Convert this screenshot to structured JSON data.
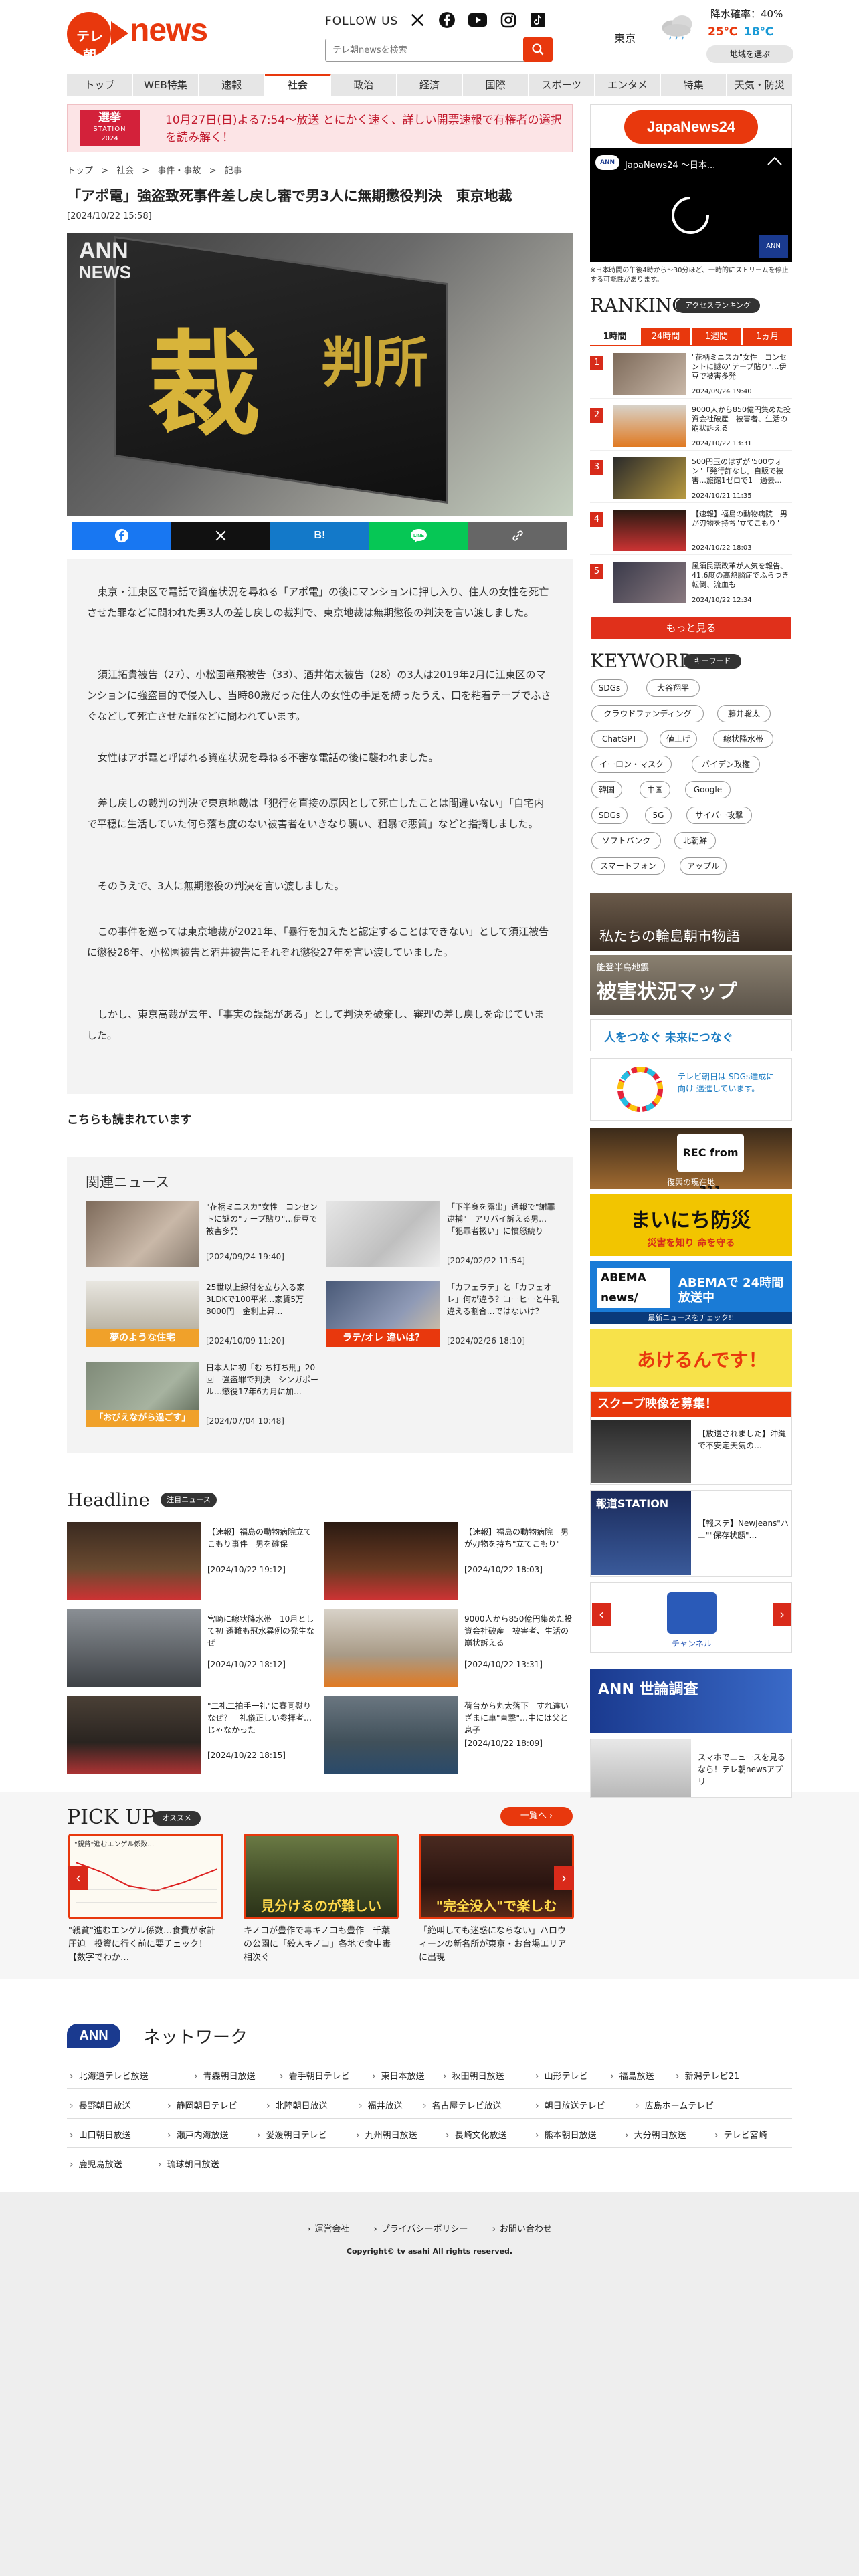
{
  "header": {
    "logo_tv": "テレ朝",
    "logo_news": "news",
    "follow_us": "FOLLOW US",
    "search_placeholder": "テレ朝newsを検索",
    "weather": {
      "city": "東京",
      "rain_label": "降水確率：40%",
      "high": "25℃",
      "low": "18℃",
      "pick_area": "地域を選ぶ"
    }
  },
  "nav": [
    "トップ",
    "WEB特集",
    "速報",
    "社会",
    "政治",
    "経済",
    "国際",
    "スポーツ",
    "エンタメ",
    "特集",
    "天気・防災"
  ],
  "nav_active": "社会",
  "election": {
    "logo_line1": "選挙",
    "logo_line2": "STATION",
    "logo_line3": "2024",
    "text": "10月27日(日)よる7:54〜放送 とにかく速く、詳しい開票速報で有権者の選択を読み解く！"
  },
  "breadcrumb": [
    "トップ",
    "社会",
    "事件・事故",
    "記事"
  ],
  "article": {
    "title": "「アポ電」強盗致死事件差し戻し審で男3人に無期懲役判決　東京地裁",
    "date": "[2024/10/22 15:58]",
    "image_watermark_1": "ANN",
    "image_watermark_2": "NEWS",
    "image_kanji_big": "裁",
    "image_kanji_small": "判所",
    "paragraphs": [
      "東京・江東区で電話で資産状況を尋ねる「アポ電」の後にマンションに押し入り、住人の女性を死亡させた罪などに問われた男3人の差し戻しの裁判で、東京地裁は無期懲役の判決を言い渡しました。",
      "須江拓貴被告（27）、小松園竜飛被告（33）、酒井佑太被告（28）の3人は2019年2月に江東区のマンションに強盗目的で侵入し、当時80歳だった住人の女性の手足を縛ったうえ、口を粘着テープでふさぐなどして死亡させた罪などに問われています。",
      "女性はアポ電と呼ばれる資産状況を尋ねる不審な電話の後に襲われました。",
      "差し戻しの裁判の判決で東京地裁は「犯行を直接の原因として死亡したことは間違いない」「自宅内で平穏に生活していた何ら落ち度のない被害者をいきなり襲い、粗暴で悪質」などと指摘しました。",
      "そのうえで、3人に無期懲役の判決を言い渡しました。",
      "この事件を巡っては東京地裁が2021年、「暴行を加えたと認定することはできない」として須江被告に懲役28年、小松園被告と酒井被告にそれぞれ懲役27年を言い渡していました。",
      "しかし、東京高裁が去年、「事実の誤認がある」として判決を破棄し、審理の差し戻しを命じていました。"
    ]
  },
  "read_also": "こちらも読まれています",
  "related": {
    "title": "関連ニュース",
    "items": [
      {
        "text": "\"花柄ミニスカ\"女性　コンセントに謎の\"テープ貼り\"…伊豆で被害多発",
        "date": "[2024/09/24 19:40]",
        "img_caption": ""
      },
      {
        "text": "「下半身を露出」通報で\"謝罪逮捕\"　アリバイ訴える男…「犯罪者扱い」に憤怒続り",
        "date": "[2024/02/22 11:54]",
        "img_caption": ""
      },
      {
        "text": "25世以上緑付を立ち入る家　3LDKで100平米…家賃5万8000円　金利上昇…",
        "date": "[2024/10/09 11:20]",
        "img_caption": "夢のような住宅"
      },
      {
        "text": "「カフェラテ」と「カフェオレ」何が違う？コーヒーと牛乳違える割合…ではないけ？",
        "date": "[2024/02/26 18:10]",
        "img_caption": "ラテ/オレ 違いは？"
      },
      {
        "text": "日本人に初「む ち打ち刑」20回　強盗罪で判決　シンガポール…懲役17年6カ月に加…",
        "date": "[2024/07/04 10:48]",
        "img_caption": "「おびえながら過ごす」"
      }
    ]
  },
  "headline": {
    "title": "Headline",
    "pill": "注目ニュース",
    "items": [
      {
        "text": "【速報】福島の動物病院立てこもり事件　男を確保",
        "date": "[2024/10/22 19:12]"
      },
      {
        "text": "【速報】福島の動物病院　男が刃物を持ち\"立てこもり\"",
        "date": "[2024/10/22 18:03]"
      },
      {
        "text": "宮崎に線状降水帯　10月として初 避難も冠水異例の発生なぜ",
        "date": "[2024/10/22 18:12]"
      },
      {
        "text": "9000人から850億円集めた投資会社破産　被害者、生活の崩状訴える",
        "date": "[2024/10/22 13:31]"
      },
      {
        "text": "\"二礼二拍手一礼\"に賽同慰り　なぜ？　礼儀正しい参拝者…じゃなかった",
        "date": "[2024/10/22 18:15]"
      },
      {
        "text": "荷台から丸太落下　すれ違いざまに車\"直撃\"…中には父と息子",
        "date": "[2024/10/22 18:09]"
      }
    ]
  },
  "pickup": {
    "title": "PICK UP",
    "pill": "オススメ",
    "all_link": "一覧へ ›",
    "items": [
      {
        "text": "\"親貧\"進むエンゲル係数…食費が家計圧迫　投資に行く前に要チェック！【数字でわか…",
        "caption": "\"親貧\"進むエンゲル係数…"
      },
      {
        "text": "キノコが豊作で毒キノコも豊作　千葉の公園に「殺人キノコ」各地で食中毒相次ぐ",
        "caption": "見分けるのが難しい"
      },
      {
        "text": "「絶叫しても迷惑にならない」ハロウィーンの新名所が東京・お台場エリアに出現",
        "caption": "\"完全没入\"で楽しむ"
      }
    ]
  },
  "network": {
    "logo": "ANN",
    "label": "ネットワーク",
    "rows": [
      [
        "北海道テレビ放送",
        "青森朝日放送",
        "岩手朝日テレビ",
        "東日本放送",
        "秋田朝日放送",
        "山形テレビ",
        "福島放送",
        "新潟テレビ21"
      ],
      [
        "長野朝日放送",
        "静岡朝日テレビ",
        "北陸朝日放送",
        "福井放送",
        "名古屋テレビ放送",
        "朝日放送テレビ",
        "広島ホームテレビ"
      ],
      [
        "山口朝日放送",
        "瀬戸内海放送",
        "愛媛朝日テレビ",
        "九州朝日放送",
        "長崎文化放送",
        "熊本朝日放送",
        "大分朝日放送",
        "テレビ宮崎"
      ],
      [
        "鹿児島放送",
        "琉球朝日放送"
      ]
    ]
  },
  "footer": {
    "links": [
      "運営会社",
      "プライバシーポリシー",
      "お問い合わせ"
    ],
    "copyright": "Copyright© tv asahi All rights reserved."
  },
  "sidebar": {
    "japannews24": "JapaNews24",
    "video_title": "JapaNews24 ～日本...",
    "video_note": "※日本時間の午後4時から～30分ほど、一時的にストリームを停止する可能性があります。",
    "ranking_title": "RANKING",
    "ranking_pill": "アクセスランキング",
    "ranking_tabs": [
      "1時間",
      "24時間",
      "1週間",
      "1ヵ月"
    ],
    "ranking_items": [
      {
        "rank": "1",
        "text": "\"花柄ミニスカ\"女性　コンセントに謎の\"テープ貼り\"…伊豆で被害多発",
        "date": "2024/09/24 19:40"
      },
      {
        "rank": "2",
        "text": "9000人から850億円集めた投資会社破産　被害者、生活の崩状訴える",
        "date": "2024/10/22 13:31"
      },
      {
        "rank": "3",
        "text": "500円玉のはずが\"500ウォン\"「発行許なし」自販で被害…旅館1ゼロで1　過去...",
        "date": "2024/10/21 11:35"
      },
      {
        "rank": "4",
        "text": "【速報】福島の動物病院　男が刃物を持ち\"立てこもり\"",
        "date": "2024/10/22 18:03"
      },
      {
        "rank": "5",
        "text": "風須民票改革が人気を報告、41.6度の高熱脳症でふらつき転倒、流血も",
        "date": "2024/10/22 12:34"
      }
    ],
    "ranking_more": "もっと見る",
    "keyword_title": "KEYWORD",
    "keyword_pill": "キーワード",
    "keywords": [
      [
        "SDGs",
        "大谷翔平"
      ],
      [
        "クラウドファンディング",
        "藤井聡太"
      ],
      [
        "ChatGPT",
        "値上げ",
        "線状降水帯"
      ],
      [
        "イーロン・マスク",
        "バイデン政権"
      ],
      [
        "韓国",
        "中国",
        "Google"
      ],
      [
        "SDGs",
        "5G",
        "サイバー攻撃"
      ],
      [
        "ソフトバンク",
        "北朝鮮"
      ],
      [
        "スマートフォン",
        "アップル"
      ]
    ],
    "banners": {
      "wajima": "私たちの輪島朝市物語",
      "noto_map_top": "能登半島地震",
      "noto_map": "被害状況マップ",
      "sdgs1": "人をつなぐ 未来につなぐ",
      "sdgs2": "テレビ朝日は SDGs達成に向け 邁進しています。",
      "rec311": "REC from 311",
      "rec311_sub": "復興の現在地",
      "bousai": "まいにち防災",
      "bousai_sub": "災害を知り 命を守る",
      "abema_news": "ABEMA news/",
      "abema_text": "ABEMAで 24時間放送中",
      "abema_sub": "最新ニュースをチェック!!",
      "akedan": "あけるんです！",
      "scoop": "スクープ映像を募集！",
      "scoop_sub": "【放送されました】沖縄で不安定天気の…",
      "houdou": "報道STATION",
      "houdou_sub": "【報ステ】NewJeans\"ハニ\"\"保存状態\"…",
      "channel_label": "チャンネル",
      "survey": "ANN 世論調査",
      "app_text": "スマホでニュースを見るなら！テレ朝newsアプリ"
    }
  }
}
